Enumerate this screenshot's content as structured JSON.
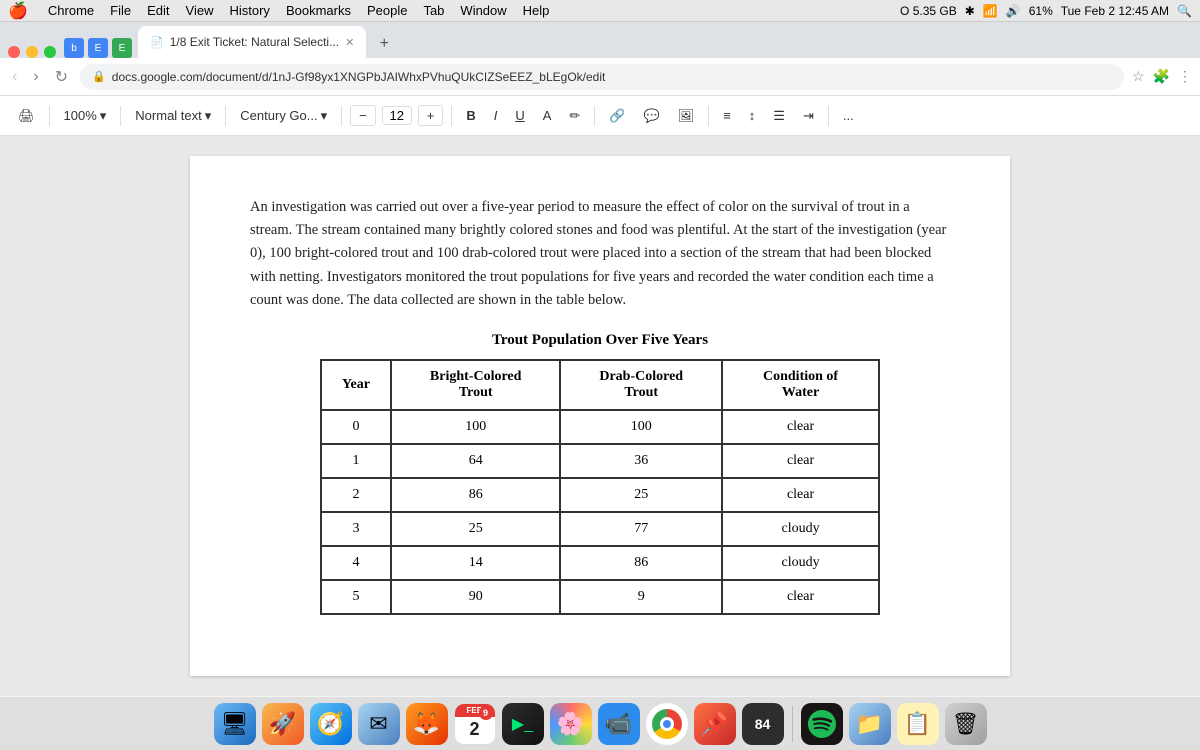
{
  "menubar": {
    "apple": "🍎",
    "items": [
      "Chrome",
      "File",
      "Edit",
      "View",
      "History",
      "Bookmarks",
      "People",
      "Tab",
      "Window",
      "Help"
    ],
    "right": {
      "disk": "O 5.35 GB",
      "bluetooth": "✱",
      "wifi": "◀",
      "volume": "◀)",
      "battery": "61%",
      "datetime": "Tue Feb 2  12:45 AM"
    }
  },
  "browser": {
    "tab_label": "1/8 Exit Ticket: Natural Selecti...",
    "tab_new": "+",
    "address": "docs.google.com/document/d/1nJ-Gf98yx1XNGPbJAIWhxPVhuQUkCIZSeEEZ_bLEgOk/edit"
  },
  "toolbar": {
    "zoom": "100%",
    "style": "Normal text",
    "font": "Century Go...",
    "font_size": "12",
    "bold": "B",
    "italic": "I",
    "underline": "U",
    "more": "..."
  },
  "document": {
    "body_text": "An investigation was carried out over a five-year period to measure the effect of color on the survival of trout in a stream. The stream contained many brightly colored stones and food was plentiful. At the start of the investigation (year 0), 100 bright-colored trout and 100 drab-colored trout were placed into a section of the stream that had been blocked with netting. Investigators monitored the trout populations for five years and recorded the water condition each time a count was done. The data collected are shown in the table below.",
    "table_title": "Trout Population Over Five Years",
    "table_headers": [
      "Year",
      "Bright-Colored Trout",
      "Drab-Colored Trout",
      "Condition of Water"
    ],
    "table_rows": [
      {
        "year": "0",
        "bright": "100",
        "drab": "100",
        "condition": "clear"
      },
      {
        "year": "1",
        "bright": "64",
        "drab": "36",
        "condition": "clear"
      },
      {
        "year": "2",
        "bright": "86",
        "drab": "25",
        "condition": "clear"
      },
      {
        "year": "3",
        "bright": "25",
        "drab": "77",
        "condition": "cloudy"
      },
      {
        "year": "4",
        "bright": "14",
        "drab": "86",
        "condition": "cloudy"
      },
      {
        "year": "5",
        "bright": "90",
        "drab": "9",
        "condition": "clear"
      }
    ]
  },
  "dock": {
    "items": [
      {
        "name": "finder",
        "label": "Finder",
        "icon": "🖥"
      },
      {
        "name": "launchpad",
        "label": "Launchpad",
        "icon": "🚀"
      },
      {
        "name": "safari",
        "label": "Safari",
        "icon": "🧭"
      },
      {
        "name": "stamps",
        "label": "Stamps",
        "icon": "✉"
      },
      {
        "name": "firefox",
        "label": "Firefox",
        "icon": "🦊"
      },
      {
        "name": "calendar",
        "label": "Calendar",
        "date": "2",
        "month": "FEB"
      },
      {
        "name": "iterm",
        "label": "iTerm2",
        "icon": "▶"
      },
      {
        "name": "photos",
        "label": "Photos",
        "icon": "🌸"
      },
      {
        "name": "zoom",
        "label": "Zoom",
        "icon": "📹"
      },
      {
        "name": "chrome",
        "label": "Chrome",
        "icon": "●"
      },
      {
        "name": "notch",
        "label": "Notch",
        "icon": "■"
      },
      {
        "name": "num84",
        "label": "84",
        "icon": "84"
      },
      {
        "name": "spotify",
        "label": "Spotify",
        "icon": "♫"
      },
      {
        "name": "finder2",
        "label": "Finder2",
        "icon": "📁"
      },
      {
        "name": "notes",
        "label": "Notes",
        "icon": "📝"
      },
      {
        "name": "trash",
        "label": "Trash",
        "icon": "🗑"
      }
    ]
  }
}
